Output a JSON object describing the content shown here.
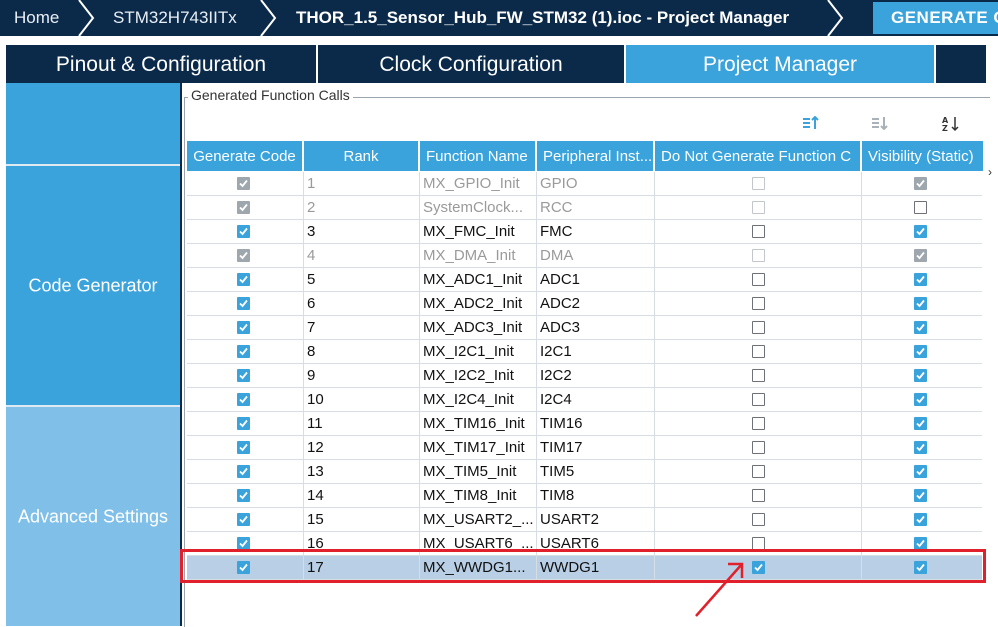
{
  "breadcrumb": {
    "home": "Home",
    "device": "STM32H743IITx",
    "project": "THOR_1.5_Sensor_Hub_FW_STM32 (1).ioc - Project Manager",
    "generate_label": "GENERATE CODE"
  },
  "tabs": [
    {
      "label": "Pinout & Configuration",
      "active": false
    },
    {
      "label": "Clock Configuration",
      "active": false
    },
    {
      "label": "Project Manager",
      "active": true
    }
  ],
  "sidebar": {
    "items": [
      {
        "label": ""
      },
      {
        "label": "Code Generator"
      },
      {
        "label": "Advanced Settings"
      }
    ]
  },
  "group": {
    "title": "Generated Function Calls",
    "sort_icons": [
      "sort-up-icon",
      "sort-down-icon",
      "sort-az-icon"
    ]
  },
  "table": {
    "headers": [
      "Generate Code",
      "Rank",
      "Function Name",
      "Peripheral Inst...",
      "Do Not Generate Function C",
      "Visibility (Static)"
    ],
    "rows": [
      {
        "gen": true,
        "gen_dis": true,
        "rank": "1",
        "func": "MX_GPIO_Init",
        "periph": "GPIO",
        "nogen": false,
        "nogen_dis": true,
        "vis": true,
        "vis_dis": true,
        "dim": true
      },
      {
        "gen": true,
        "gen_dis": true,
        "rank": "2",
        "func": "SystemClock...",
        "periph": "RCC",
        "nogen": false,
        "nogen_dis": true,
        "vis": false,
        "vis_dis": false,
        "dim": true
      },
      {
        "gen": true,
        "gen_dis": false,
        "rank": "3",
        "func": "MX_FMC_Init",
        "periph": "FMC",
        "nogen": false,
        "nogen_dis": false,
        "vis": true,
        "vis_dis": false,
        "dim": false
      },
      {
        "gen": true,
        "gen_dis": true,
        "rank": "4",
        "func": "MX_DMA_Init",
        "periph": "DMA",
        "nogen": false,
        "nogen_dis": true,
        "vis": true,
        "vis_dis": true,
        "dim": true
      },
      {
        "gen": true,
        "gen_dis": false,
        "rank": "5",
        "func": "MX_ADC1_Init",
        "periph": "ADC1",
        "nogen": false,
        "nogen_dis": false,
        "vis": true,
        "vis_dis": false,
        "dim": false
      },
      {
        "gen": true,
        "gen_dis": false,
        "rank": "6",
        "func": "MX_ADC2_Init",
        "periph": "ADC2",
        "nogen": false,
        "nogen_dis": false,
        "vis": true,
        "vis_dis": false,
        "dim": false
      },
      {
        "gen": true,
        "gen_dis": false,
        "rank": "7",
        "func": "MX_ADC3_Init",
        "periph": "ADC3",
        "nogen": false,
        "nogen_dis": false,
        "vis": true,
        "vis_dis": false,
        "dim": false
      },
      {
        "gen": true,
        "gen_dis": false,
        "rank": "8",
        "func": "MX_I2C1_Init",
        "periph": "I2C1",
        "nogen": false,
        "nogen_dis": false,
        "vis": true,
        "vis_dis": false,
        "dim": false
      },
      {
        "gen": true,
        "gen_dis": false,
        "rank": "9",
        "func": "MX_I2C2_Init",
        "periph": "I2C2",
        "nogen": false,
        "nogen_dis": false,
        "vis": true,
        "vis_dis": false,
        "dim": false
      },
      {
        "gen": true,
        "gen_dis": false,
        "rank": "10",
        "func": "MX_I2C4_Init",
        "periph": "I2C4",
        "nogen": false,
        "nogen_dis": false,
        "vis": true,
        "vis_dis": false,
        "dim": false
      },
      {
        "gen": true,
        "gen_dis": false,
        "rank": "11",
        "func": "MX_TIM16_Init",
        "periph": "TIM16",
        "nogen": false,
        "nogen_dis": false,
        "vis": true,
        "vis_dis": false,
        "dim": false
      },
      {
        "gen": true,
        "gen_dis": false,
        "rank": "12",
        "func": "MX_TIM17_Init",
        "periph": "TIM17",
        "nogen": false,
        "nogen_dis": false,
        "vis": true,
        "vis_dis": false,
        "dim": false
      },
      {
        "gen": true,
        "gen_dis": false,
        "rank": "13",
        "func": "MX_TIM5_Init",
        "periph": "TIM5",
        "nogen": false,
        "nogen_dis": false,
        "vis": true,
        "vis_dis": false,
        "dim": false
      },
      {
        "gen": true,
        "gen_dis": false,
        "rank": "14",
        "func": "MX_TIM8_Init",
        "periph": "TIM8",
        "nogen": false,
        "nogen_dis": false,
        "vis": true,
        "vis_dis": false,
        "dim": false
      },
      {
        "gen": true,
        "gen_dis": false,
        "rank": "15",
        "func": "MX_USART2_...",
        "periph": "USART2",
        "nogen": false,
        "nogen_dis": false,
        "vis": true,
        "vis_dis": false,
        "dim": false
      },
      {
        "gen": true,
        "gen_dis": false,
        "rank": "16",
        "func": "MX_USART6_...",
        "periph": "USART6",
        "nogen": false,
        "nogen_dis": false,
        "vis": true,
        "vis_dis": false,
        "dim": false
      },
      {
        "gen": true,
        "gen_dis": false,
        "rank": "17",
        "func": "MX_WWDG1...",
        "periph": "WWDG1",
        "nogen": true,
        "nogen_dis": false,
        "vis": true,
        "vis_dis": false,
        "dim": false,
        "selected": true
      }
    ]
  },
  "colors": {
    "header_dark": "#0b2a4a",
    "accent": "#3aa3db",
    "highlight": "#e0202b",
    "selected_row": "#b8cfe6"
  }
}
